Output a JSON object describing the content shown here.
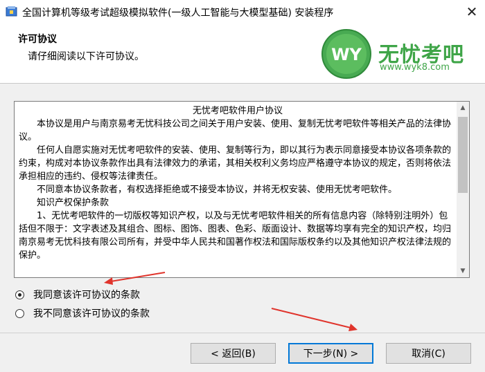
{
  "window": {
    "title": "全国计算机等级考试超级模拟软件(一级人工智能与大模型基础) 安装程序",
    "close_glyph": "✕"
  },
  "header": {
    "title": "许可协议",
    "subtitle": "请仔细阅读以下许可协议。"
  },
  "logo": {
    "mark": "WY",
    "name": "无忧考吧",
    "url": "www.wyk8.com",
    "color": "#3fa548"
  },
  "license": {
    "title": "无忧考吧软件用户协议",
    "paragraphs": [
      "　　本协议是用户与南京易考无忧科技公司之间关于用户安装、使用、复制无忧考吧软件等相关产品的法律协议。",
      "　　任何人自愿实施对无忧考吧软件的安装、使用、复制等行为，即以其行为表示同意接受本协议各项条款的约束，构成对本协议条款作出具有法律效力的承诺，其相关权利义务均应严格遵守本协议的规定，否则将依法承担相应的违约、侵权等法律责任。",
      "　　不同意本协议条款者，有权选择拒绝或不接受本协议，并将无权安装、使用无忧考吧软件。",
      "　　知识产权保护条款",
      "　　1、无忧考吧软件的一切版权等知识产权，以及与无忧考吧软件相关的所有信息内容（除特别注明外）包括但不限于：文字表述及其组合、图标、图饰、图表、色彩、版面设计、数据等均享有完全的知识产权，均归南京易考无忧科技有限公司所有，并受中华人民共和国著作权法和国际版权条约以及其他知识产权法律法规的保护。"
    ]
  },
  "options": {
    "agree": "我同意该许可协议的条款",
    "disagree": "我不同意该许可协议的条款",
    "selected": "agree"
  },
  "buttons": {
    "back": "< 返回(B)",
    "next": "下一步(N) >",
    "cancel": "取消(C)"
  },
  "colors": {
    "annotation_arrow": "#e0342c",
    "focus_border": "#0078d7"
  }
}
